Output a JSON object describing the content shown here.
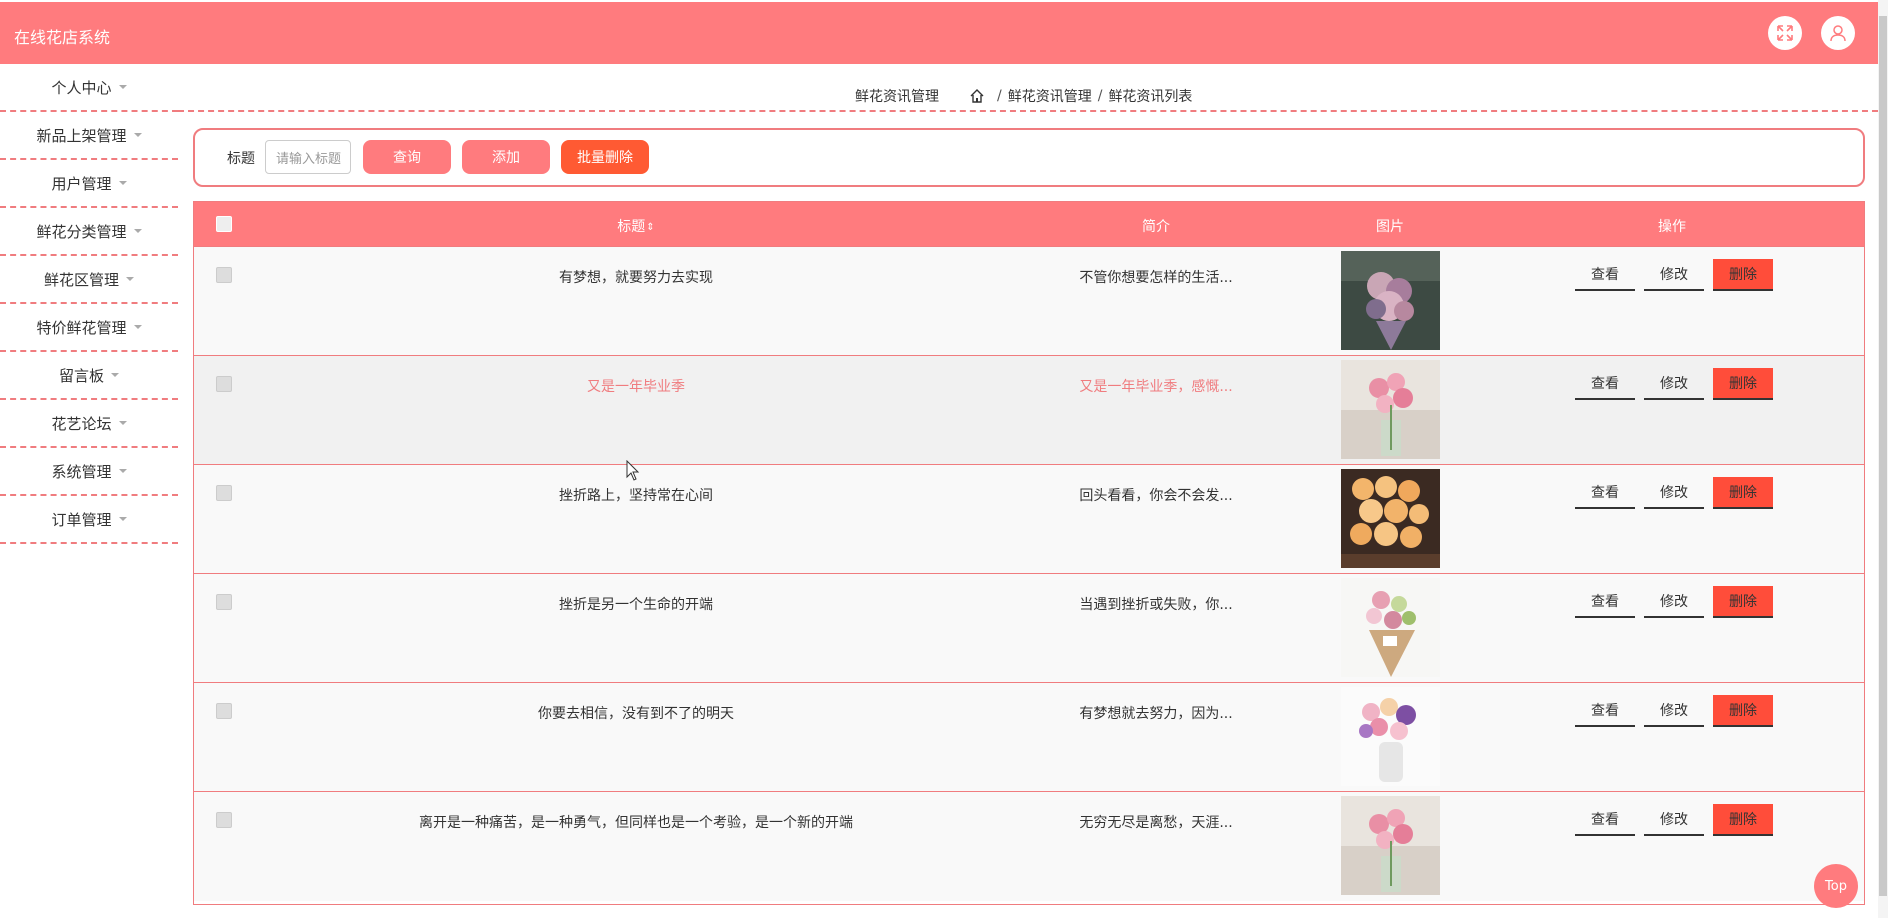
{
  "header": {
    "title": "在线花店系统",
    "icons": [
      "fullscreen-icon",
      "user-icon"
    ]
  },
  "sidebar": {
    "items": [
      {
        "label": "个人中心"
      },
      {
        "label": "新品上架管理"
      },
      {
        "label": "用户管理"
      },
      {
        "label": "鲜花分类管理"
      },
      {
        "label": "鲜花区管理"
      },
      {
        "label": "特价鲜花管理"
      },
      {
        "label": "留言板"
      },
      {
        "label": "花艺论坛"
      },
      {
        "label": "系统管理"
      },
      {
        "label": "订单管理"
      }
    ]
  },
  "breadcrumb": {
    "page_title": "鲜花资讯管理",
    "level1": "鲜花资讯管理",
    "level2": "鲜花资讯列表",
    "separator": "/"
  },
  "search": {
    "label": "标题",
    "placeholder": "请输入标题",
    "query_label": "查询",
    "add_label": "添加",
    "batch_delete_label": "批量删除"
  },
  "table": {
    "columns": {
      "title": "标题",
      "intro": "简介",
      "image": "图片",
      "actions": "操作"
    },
    "action_labels": {
      "view": "查看",
      "edit": "修改",
      "delete": "删除"
    },
    "rows": [
      {
        "title": "有梦想，就要努力去实现",
        "intro": "不管你想要怎样的生活...",
        "image": "bouquet-purple-pink"
      },
      {
        "title": "又是一年毕业季",
        "intro": "又是一年毕业季，感慨...",
        "image": "pink-roses-vase"
      },
      {
        "title": "挫折路上，坚持常在心间",
        "intro": "回头看看，你会不会发...",
        "image": "orange-roses-box"
      },
      {
        "title": "挫折是另一个生命的开端",
        "intro": "当遇到挫折或失败，你...",
        "image": "mixed-bouquet-paper"
      },
      {
        "title": "你要去相信，没有到不了的明天",
        "intro": "有梦想就去努力，因为...",
        "image": "pink-purple-vase"
      },
      {
        "title": "离开是一种痛苦，是一种勇气，但同样也是一个考验，是一个新的开端",
        "intro": "无穷无尽是离愁，天涯...",
        "image": "pink-roses-vase"
      }
    ]
  },
  "back_to_top": "Top",
  "colors": {
    "primary": "#ff7b7e",
    "danger": "#ff4d3a",
    "orange": "#ff5a33"
  }
}
